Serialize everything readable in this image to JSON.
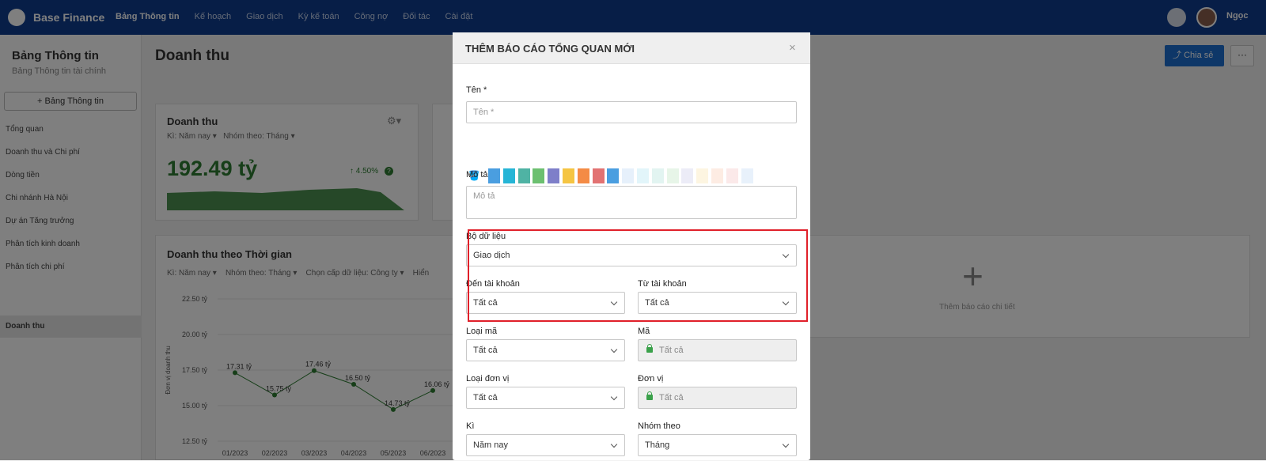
{
  "app": {
    "brand": "Base Finance",
    "user_name": "Ngọc"
  },
  "nav": [
    "Bảng Thông tin",
    "Kế hoạch",
    "Giao dịch",
    "Kỳ kế toán",
    "Công nợ",
    "Đối tác",
    "Cài đặt"
  ],
  "sidebar": {
    "title": "Bảng Thông tin",
    "subtitle": "Bảng Thông tin tài chính",
    "add_label": "+ Bảng Thông tin",
    "items": [
      "Tổng quan",
      "Doanh thu và Chi phí",
      "Dòng tiền",
      "Chi nhánh Hà Nội",
      "Dự án Tăng trưởng",
      "Phân tích kinh doanh",
      "Phân tích chi phí",
      "Doanh thu"
    ]
  },
  "page": {
    "title": "Doanh thu",
    "share_label": "Chia sẻ",
    "more_label": "···"
  },
  "kpi_card": {
    "title": "Doanh thu",
    "period": "Kì: Năm nay",
    "group": "Nhóm theo: Tháng",
    "value": "192.49 tỷ",
    "change": "4.50%",
    "help": "?"
  },
  "time_card": {
    "title": "Doanh thu theo Thời gian",
    "period": "Kì: Năm nay",
    "group": "Nhóm theo: Tháng",
    "level": "Chọn cấp dữ liệu: Công ty",
    "extra": "Hiển"
  },
  "add_detail": {
    "label": "Thêm báo cáo chi tiết",
    "icon": "+"
  },
  "chart_data": {
    "type": "line",
    "x": [
      "01/2023",
      "02/2023",
      "03/2023",
      "04/2023",
      "05/2023",
      "06/2023"
    ],
    "series": [
      {
        "values": [
          17.31,
          15.75,
          17.46,
          16.5,
          14.73,
          16.06
        ]
      }
    ],
    "data_labels": [
      "17.31 tỷ",
      "15.75 tỷ",
      "17.46 tỷ",
      "16.50 tỷ",
      "14.73 tỷ",
      "16.06 tỷ"
    ],
    "yticks": [
      "22.50 tỷ",
      "20.00 tỷ",
      "17.50 tỷ",
      "15.00 tỷ",
      "12.50 tỷ"
    ],
    "ytick_values": [
      22.5,
      20,
      17.5,
      15,
      12.5
    ],
    "ylabel": "Đơn vị doanh thu",
    "ylim": [
      12.5,
      22.5
    ],
    "color": "#2e7d32"
  },
  "modal": {
    "title": "THÊM BÁO CÁO TỔNG QUAN MỚI",
    "close": "×",
    "name_label": "Tên *",
    "name_placeholder": "Tên *",
    "desc_label": "Mô tả",
    "desc_placeholder": "Mô tả",
    "colors": [
      "#4a9ee0",
      "#26b5d6",
      "#4fb3a4",
      "#6cc070",
      "#7e7fc9",
      "#f5c542",
      "#f48b45",
      "#e27272",
      "#4a9ee0",
      "#e6f0fb",
      "#e2f5fa",
      "#e2f4f1",
      "#e7f5e8",
      "#ececf7",
      "#fdf5e1",
      "#fdece3",
      "#fbe9e9",
      "#e8f1fb"
    ],
    "dataset_label": "Bộ dữ liệu",
    "dataset_value": "Giao dịch",
    "to_account_label": "Đến tài khoản",
    "to_account_value": "Tất cả",
    "from_account_label": "Từ tài khoản",
    "from_account_value": "Tất cả",
    "code_type_label": "Loại mã",
    "code_type_value": "Tất cả",
    "code_label": "Mã",
    "code_value": "Tất cả",
    "unit_type_label": "Loại đơn vị",
    "unit_type_value": "Tất cả",
    "unit_label": "Đơn vị",
    "unit_value": "Tất cả",
    "period_label": "Kì",
    "period_value": "Năm nay",
    "group_label": "Nhóm theo",
    "group_value": "Tháng"
  }
}
